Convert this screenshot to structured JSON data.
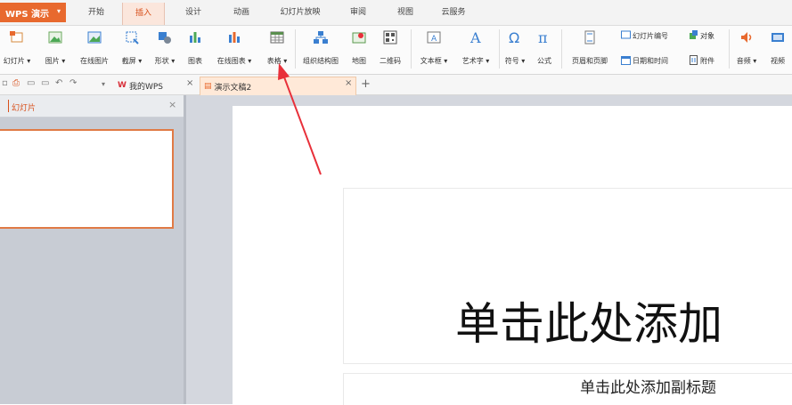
{
  "app": {
    "name": "WPS 演示",
    "dropdown": "▾"
  },
  "menu_tabs": [
    "开始",
    "插入",
    "设计",
    "动画",
    "幻灯片放映",
    "审阅",
    "视图",
    "云服务"
  ],
  "ribbon": {
    "new_slide": "幻灯片 ▾",
    "picture": "图片 ▾",
    "online_picture": "在线图片",
    "screenshot": "截屏 ▾",
    "shape": "形状 ▾",
    "chart": "图表",
    "online_chart": "在线图表 ▾",
    "table": "表格 ▾",
    "smartart": "组织结构图",
    "map": "地图",
    "qrcode": "二维码",
    "textbox": "文本框 ▾",
    "wordart": "艺术字 ▾",
    "symbol": "符号 ▾",
    "formula": "公式",
    "header_footer": "页眉和页脚",
    "slide_number": "幻灯片编号",
    "object": "对象",
    "datetime": "日期和时间",
    "attachment": "附件",
    "audio": "音频 ▾",
    "video": "视频"
  },
  "doc_tabs": {
    "mywps": "我的WPS",
    "doc": "演示文稿2",
    "close": "×",
    "add": "+"
  },
  "panel": {
    "title": "幻灯片",
    "close": "×"
  },
  "slide": {
    "title_placeholder": "单击此处添加",
    "subtitle_placeholder": "单击此处添加副标题"
  },
  "colors": {
    "accent": "#e8692e",
    "active_tab_bg": "#fbe6dc",
    "arrow": "#e8303a",
    "blue_icon": "#3a7fd0",
    "green_icon": "#4ca855"
  }
}
